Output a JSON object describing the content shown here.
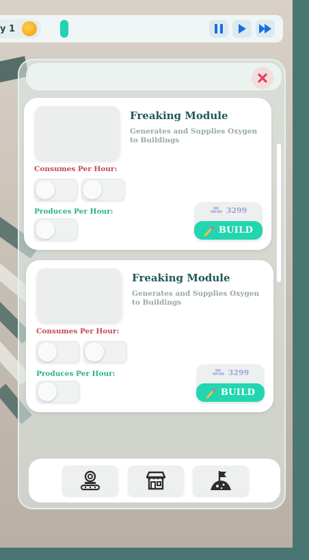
{
  "hud": {
    "day_label": "y 1",
    "speed_controls": [
      "pause-icon",
      "play-icon",
      "fast-forward-icon"
    ]
  },
  "panel": {
    "close_icon": "close-icon",
    "cards": [
      {
        "title": "Freaking Module",
        "description": "Generates and Supplies Oxygen to Buildings",
        "consumes_label": "Consumes Per Hour:",
        "produces_label": "Produces Per Hour:",
        "cost": "3299",
        "build_label": "BUILD"
      },
      {
        "title": "Freaking Module",
        "description": "Generates and Supplies Oxygen to Buildings",
        "consumes_label": "Consumes Per Hour:",
        "produces_label": "Produces Per Hour:",
        "cost": "3299",
        "build_label": "BUILD"
      }
    ]
  },
  "tabs": [
    {
      "icon": "conveyor-icon"
    },
    {
      "icon": "shop-icon"
    },
    {
      "icon": "flag-planet-icon"
    }
  ],
  "colors": {
    "accent": "#22d6b1",
    "consumes": "#c24a52",
    "produces": "#27b383",
    "title": "#1f5a58",
    "speed_icon": "#1a6fe0"
  }
}
